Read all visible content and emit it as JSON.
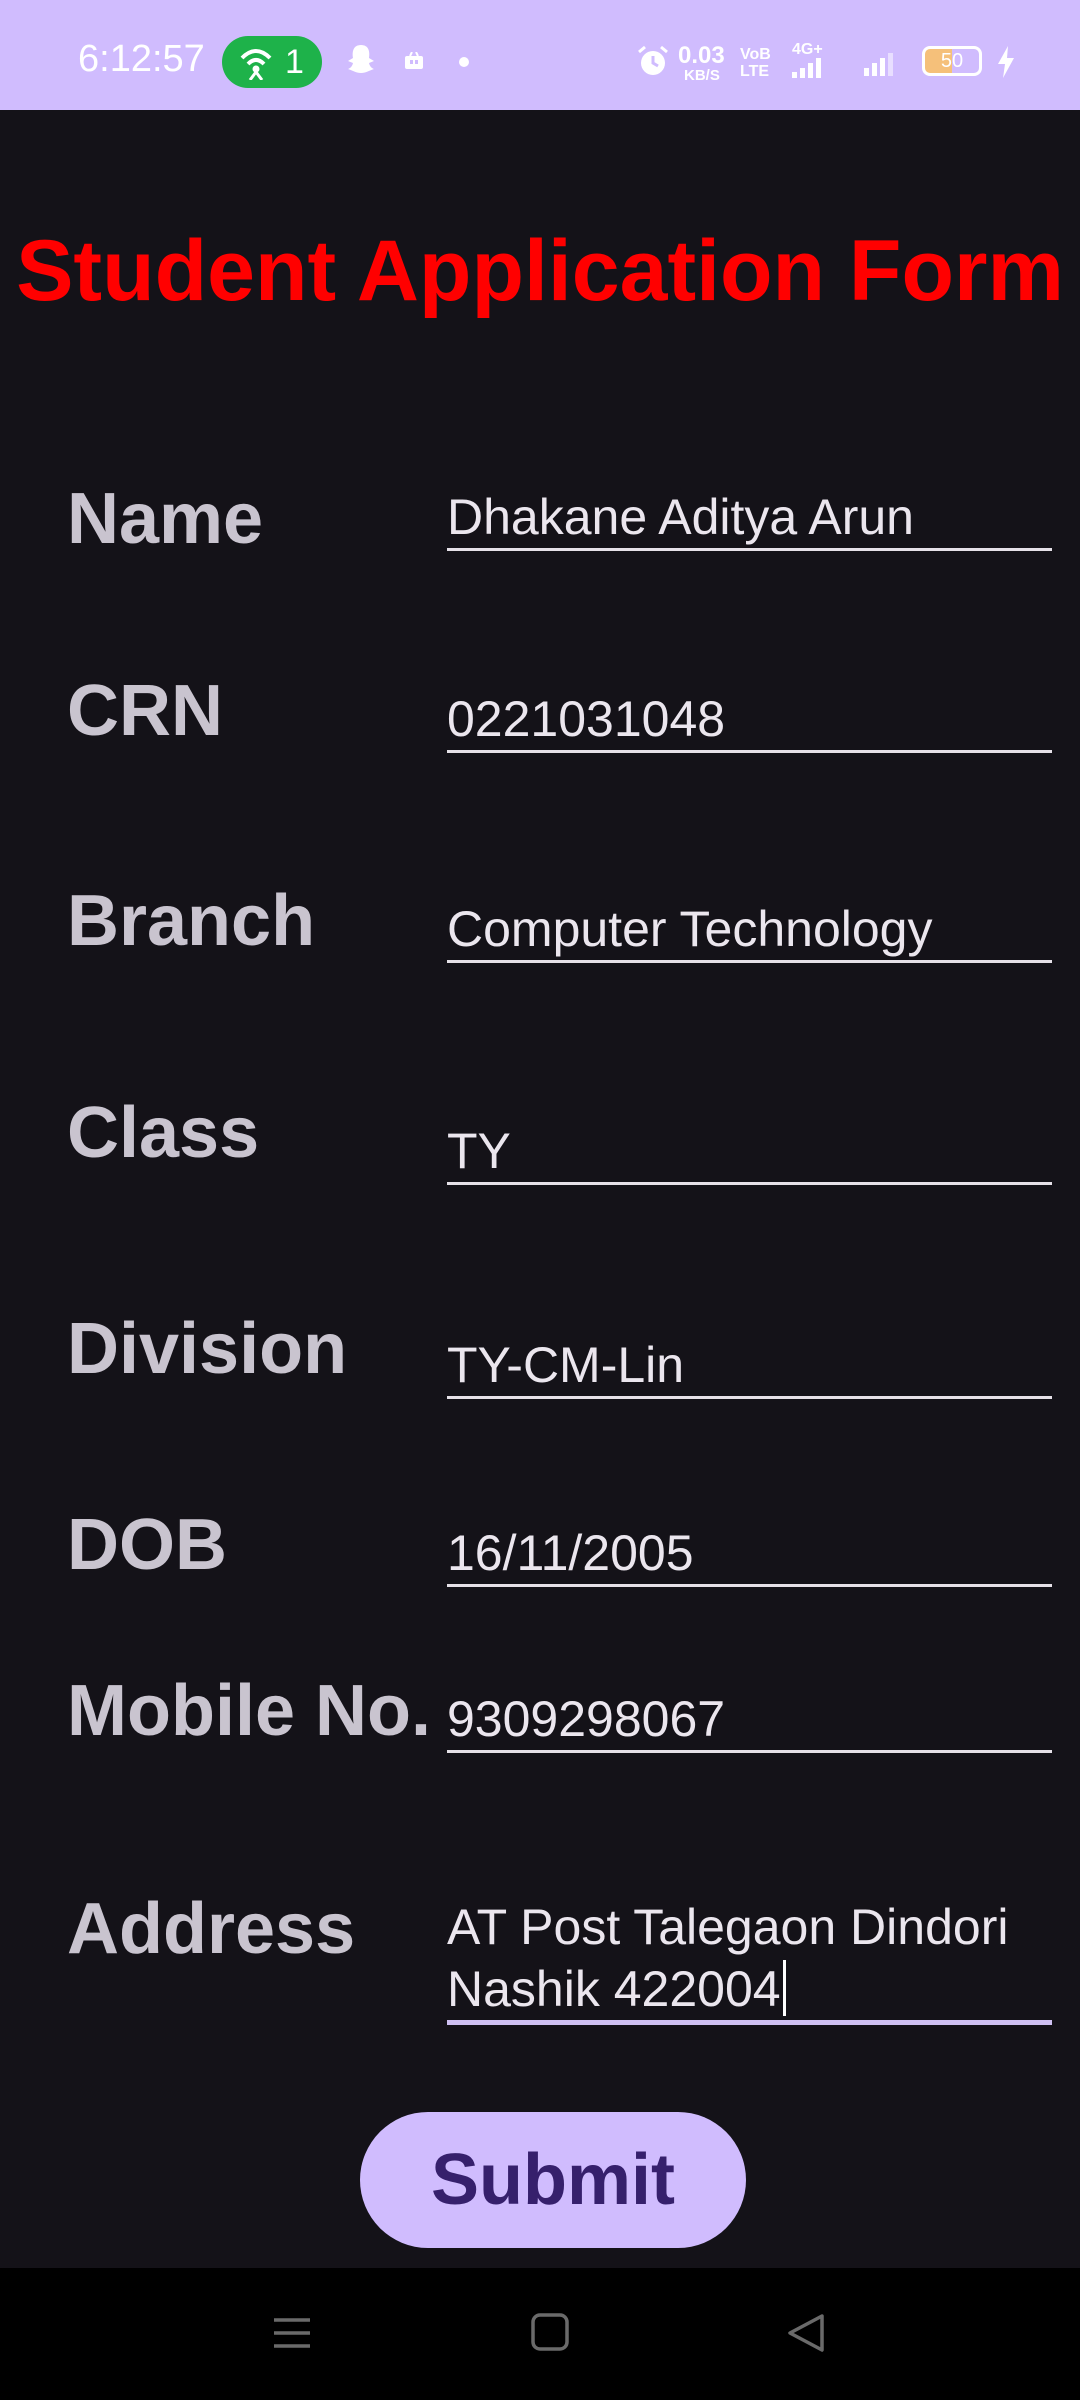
{
  "status_bar": {
    "time": "6:12:57",
    "hotspot_count": "1",
    "net_speed_value": "0.03",
    "net_speed_unit": "KB/S",
    "volte_label": "VoB LTE",
    "network_label": "4G+",
    "battery_level": "50",
    "icons": [
      "hotspot-icon",
      "snapchat-icon",
      "notification-icon",
      "dot-icon",
      "alarm-icon",
      "signal-icon",
      "battery-icon",
      "charging-icon"
    ]
  },
  "form": {
    "title": "Student Application Form",
    "fields": [
      {
        "label": "Name",
        "value": "Dhakane Aditya Arun"
      },
      {
        "label": "CRN",
        "value": "0221031048"
      },
      {
        "label": "Branch",
        "value": "Computer Technology"
      },
      {
        "label": "Class",
        "value": "TY"
      },
      {
        "label": "Division",
        "value": "TY-CM-Lin"
      },
      {
        "label": "DOB",
        "value": "16/11/2005"
      },
      {
        "label": "Mobile No.",
        "value": "9309298067"
      },
      {
        "label": "Address",
        "value": "AT Post Talegaon Dindori\nNashik 422004"
      }
    ],
    "submit_label": "Submit"
  },
  "colors": {
    "background": "#141218",
    "title": "#ff0000",
    "label": "#c9c4cf",
    "accent": "#d0bcfe",
    "button_text": "#36206c"
  },
  "nav_bar": {
    "buttons": [
      "menu-icon",
      "home-icon",
      "back-icon"
    ]
  }
}
